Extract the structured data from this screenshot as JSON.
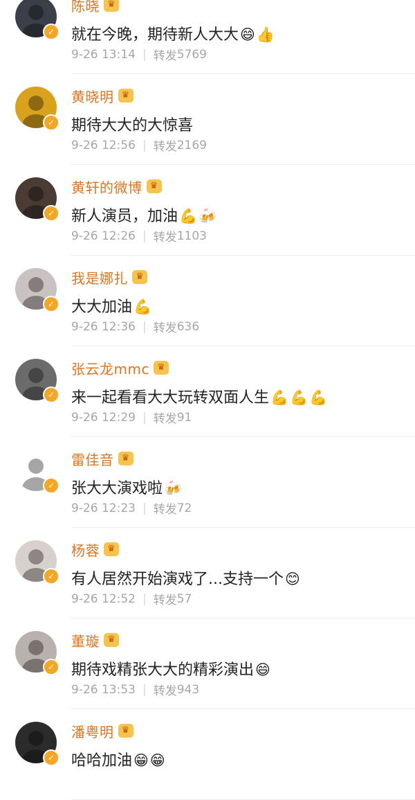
{
  "repost_label": "转发",
  "items": [
    {
      "name": "陈晓",
      "text": "就在今晚，期待新人大大",
      "emojis": [
        "😄",
        "👍"
      ],
      "time": "9-26 13:14",
      "reposts": "5769",
      "avatar_bg": "#3a3f4a"
    },
    {
      "name": "黄晓明",
      "text": "期待大大的大惊喜",
      "emojis": [],
      "time": "9-26 12:56",
      "reposts": "2169",
      "avatar_bg": "#d9a21c"
    },
    {
      "name": "黄轩的微博",
      "text": "新人演员，加油",
      "emojis": [
        "💪",
        "🍻"
      ],
      "time": "9-26 12:26",
      "reposts": "1103",
      "avatar_bg": "#4a3b33"
    },
    {
      "name": "我是娜扎",
      "text": "大大加油",
      "emojis": [
        "💪"
      ],
      "time": "9-26 12:36",
      "reposts": "636",
      "avatar_bg": "#c9c2c0"
    },
    {
      "name": "张云龙mmc",
      "text": "来一起看看大大玩转双面人生",
      "emojis": [
        "💪",
        "💪",
        "💪"
      ],
      "time": "9-26 12:29",
      "reposts": "91",
      "avatar_bg": "#6b6b6b"
    },
    {
      "name": "雷佳音",
      "text": "张大大演戏啦",
      "emojis": [
        "🍻"
      ],
      "time": "9-26 12:23",
      "reposts": "72",
      "avatar_bg": "#ffffff"
    },
    {
      "name": "杨蓉",
      "text": "有人居然开始演戏了...支持一个",
      "emojis": [
        "😊"
      ],
      "time": "9-26 12:52",
      "reposts": "57",
      "avatar_bg": "#d8d0cc"
    },
    {
      "name": "董璇",
      "text": "期待戏精张大大的精彩演出",
      "emojis": [
        "😄"
      ],
      "time": "9-26 13:53",
      "reposts": "943",
      "avatar_bg": "#b9b1ad"
    },
    {
      "name": "潘粤明",
      "text": "哈哈加油",
      "emojis": [
        "😁",
        "😁"
      ],
      "time": "",
      "reposts": "",
      "avatar_bg": "#2b2b2b"
    }
  ],
  "colors": {
    "name": "#e0751f",
    "badge": "#f5a623",
    "crown": "#f7c34a",
    "meta": "#a6a6a6"
  }
}
